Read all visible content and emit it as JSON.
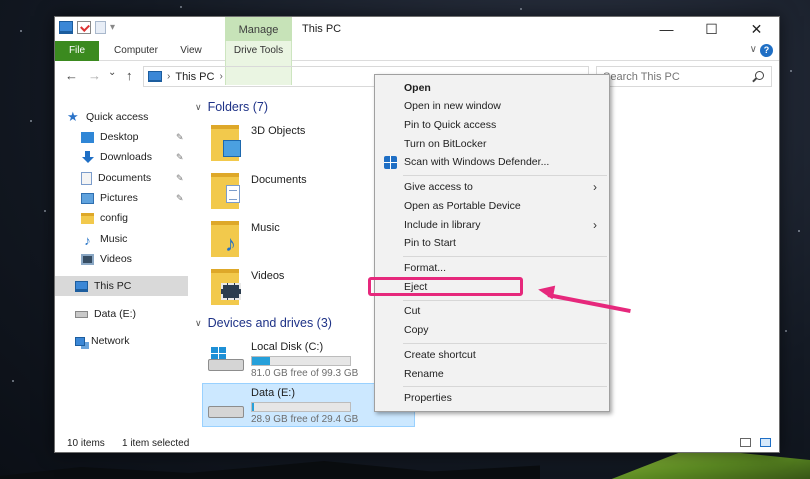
{
  "window": {
    "title": "This PC",
    "manage_tab": "Manage",
    "caption": {
      "minimize": "—",
      "maximize": "☐",
      "close": "✕"
    }
  },
  "ribbon": {
    "tabs": [
      "File",
      "Computer",
      "View",
      "Drive Tools"
    ],
    "expand_chevron": "∨",
    "help": "?"
  },
  "address": {
    "back": "←",
    "forward": "→",
    "recent": "⌄",
    "up": "↑",
    "path": "This PC",
    "path_chevron": "›"
  },
  "search": {
    "placeholder": "Search This PC"
  },
  "navpane": {
    "quick_access": "Quick access",
    "items": [
      {
        "label": "Desktop",
        "icon": "desktop-icon",
        "pinned": true
      },
      {
        "label": "Downloads",
        "icon": "downloads-icon",
        "pinned": true
      },
      {
        "label": "Documents",
        "icon": "documents-icon",
        "pinned": true
      },
      {
        "label": "Pictures",
        "icon": "pictures-icon",
        "pinned": true
      },
      {
        "label": "config",
        "icon": "folder-icon",
        "pinned": false
      },
      {
        "label": "Music",
        "icon": "music-icon",
        "pinned": false
      },
      {
        "label": "Videos",
        "icon": "videos-icon",
        "pinned": false
      }
    ],
    "this_pc": "This PC",
    "data_drive": "Data (E:)",
    "network": "Network",
    "pin_glyph": "📌"
  },
  "content": {
    "folders_header": "Folders (7)",
    "folders": [
      {
        "label": "3D Objects",
        "icon": "3d-objects-icon"
      },
      {
        "label": "Documents",
        "icon": "documents-icon"
      },
      {
        "label": "Music",
        "icon": "music-icon"
      },
      {
        "label": "Videos",
        "icon": "videos-icon"
      }
    ],
    "devices_header": "Devices and drives (3)",
    "drives": [
      {
        "name": "Local Disk (C:)",
        "free": "81.0 GB free of 99.3 GB",
        "used_fraction": 0.18,
        "icon": "windows-drive-icon"
      },
      {
        "name": "Data (E:)",
        "free": "28.9 GB free of 29.4 GB",
        "used_fraction": 0.02,
        "icon": "removable-drive-icon"
      }
    ]
  },
  "context_menu": {
    "open": "Open",
    "open_new_window": "Open in new window",
    "pin_quick_access": "Pin to Quick access",
    "bitlocker": "Turn on BitLocker",
    "defender": "Scan with Windows Defender...",
    "give_access": "Give access to",
    "portable": "Open as Portable Device",
    "library": "Include in library",
    "pin_start": "Pin to Start",
    "format": "Format...",
    "eject": "Eject",
    "cut": "Cut",
    "copy": "Copy",
    "shortcut": "Create shortcut",
    "rename": "Rename",
    "properties": "Properties",
    "submenu_arrow": "›"
  },
  "status": {
    "items": "10 items",
    "selected": "1 item selected"
  },
  "colors": {
    "accent": "#1f6fc5",
    "file_tab": "#3b8a1f",
    "manage_tab": "#c7e3b8",
    "highlight": "#e6287c",
    "selection": "#cce8ff"
  }
}
